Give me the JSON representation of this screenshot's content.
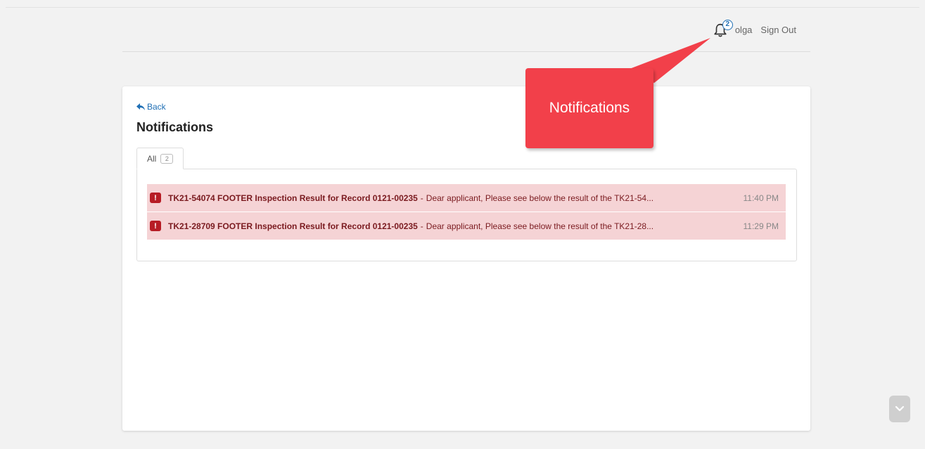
{
  "header": {
    "notification_count": "2",
    "username": "olga",
    "signout_label": "Sign Out"
  },
  "page": {
    "back_label": "Back",
    "title": "Notifications"
  },
  "tabs": [
    {
      "label": "All",
      "count": "2"
    }
  ],
  "notifications": [
    {
      "title": "TK21-54074 FOOTER Inspection Result for Record 0121-00235",
      "separator": "-",
      "body": "Dear applicant, Please see below the result of the TK21-54...",
      "time": "11:40 PM"
    },
    {
      "title": "TK21-28709 FOOTER Inspection Result for Record 0121-00235",
      "separator": "-",
      "body": "Dear applicant, Please see below the result of the TK21-28...",
      "time": "11:29 PM"
    }
  ],
  "callout": {
    "label": "Notifications",
    "color": "#f2404a"
  },
  "icons": {
    "bell": "bell-icon",
    "back": "back-arrow-icon",
    "alert": "alert-icon",
    "alert_glyph": "!",
    "scroll": "chevron-down-icon"
  },
  "colors": {
    "link": "#1f6fb5",
    "notif_bg": "#f5d3d5",
    "alert": "#b71c25"
  }
}
